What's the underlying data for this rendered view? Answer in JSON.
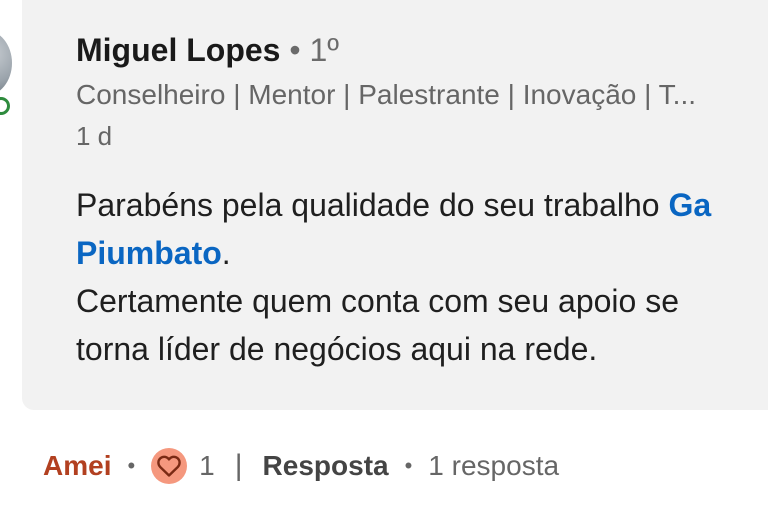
{
  "comment": {
    "author": "Miguel Lopes",
    "degree_separator": "•",
    "degree": "1º",
    "headline": "Conselheiro | Mentor | Palestrante | Inovação | T...",
    "time": "1 d",
    "body": {
      "part1": "Parabéns pela qualidade do seu trabalho ",
      "mention_line1": "Ga",
      "mention_line2": "Piumbato",
      "part2": ".",
      "line3": "Certamente quem conta com seu apoio se",
      "line4": "torna líder de negócios aqui na rede."
    }
  },
  "actions": {
    "reaction_label": "Amei",
    "separator": "•",
    "reaction_icon": "heart-icon",
    "reaction_count": "1",
    "pipe": "|",
    "reply_label": "Resposta",
    "replies_count": "1 resposta"
  },
  "colors": {
    "card_background": "#f2f2f2",
    "mention": "#0a66c2",
    "reaction": "#b24020",
    "heart_bg": "#f5987e",
    "badge": "#2e8b3d"
  }
}
